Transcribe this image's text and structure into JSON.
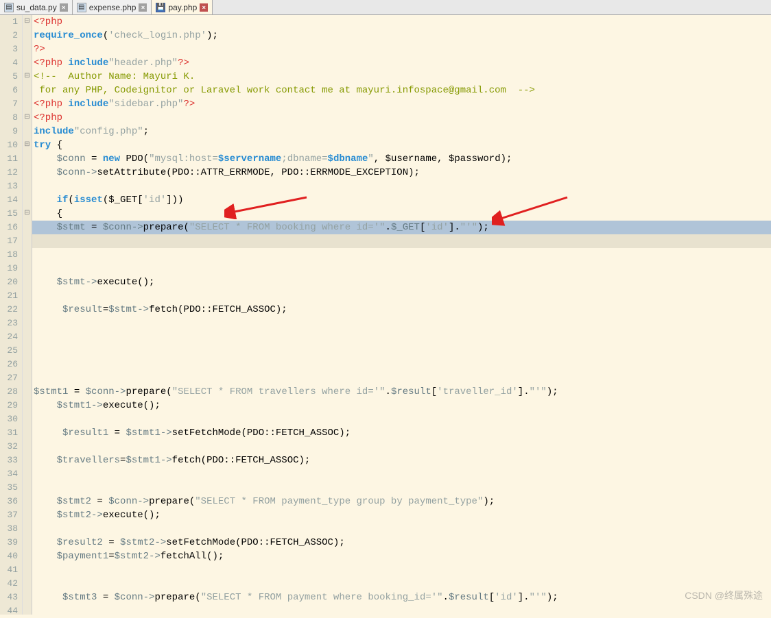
{
  "tabs": [
    {
      "label": "su_data.py",
      "icon": "file-icon",
      "closeStyle": "gray"
    },
    {
      "label": "expense.php",
      "icon": "file-icon",
      "closeStyle": "gray"
    },
    {
      "label": "pay.php",
      "icon": "save-icon",
      "active": true,
      "closeStyle": "red"
    }
  ],
  "gutter_start": 1,
  "gutter_end": 44,
  "fold_markers": {
    "1": "⊟",
    "5": "⊟",
    "8": "⊟",
    "10": "⊟",
    "15": "⊟"
  },
  "code_lines": {
    "l1": "<?php",
    "l2_a": "require_once",
    "l2_b": "(",
    "l2_c": "'check_login.php'",
    "l2_d": ");",
    "l3": "?>",
    "l4_a": "<?php ",
    "l4_b": "include",
    "l4_c": "\"header.php\"",
    "l4_d": "?>",
    "l5": "<!--  Author Name: Mayuri K. ",
    "l6": " for any PHP, Codeignitor or Laravel work contact me at mayuri.infospace@gmail.com  -->",
    "l7_a": "<?php ",
    "l7_b": "include",
    "l7_c": "\"sidebar.php\"",
    "l7_d": "?>",
    "l8": "<?php",
    "l9_a": "include",
    "l9_b": "\"config.php\"",
    "l9_c": ";",
    "l10_a": "try",
    "l10_b": " {",
    "l11_a": "    $conn",
    "l11_b": " = ",
    "l11_c": "new",
    "l11_d": " PDO(",
    "l11_e": "\"mysql:host=",
    "l11_f": "$servername",
    "l11_g": ";dbname=",
    "l11_h": "$dbname",
    "l11_i": "\"",
    "l11_j": ", $username, $password);",
    "l12_a": "    $conn",
    "l12_b": "->",
    "l12_c": "setAttribute(PDO::ATTR_ERRMODE, PDO::ERRMODE_EXCEPTION);",
    "l14_a": "    ",
    "l14_b": "if",
    "l14_c": "(",
    "l14_d": "isset",
    "l14_e": "($_GET[",
    "l14_f": "'id'",
    "l14_g": "]))",
    "l15": "    {",
    "l16_a": "    $stmt",
    "l16_b": " = ",
    "l16_c": "$conn",
    "l16_d": "->",
    "l16_e": "prepare(",
    "l16_f": "\"SELECT * FROM booking where id='\"",
    "l16_g": ".",
    "l16_h": "$_GET",
    "l16_i": "[",
    "l16_j": "'id'",
    "l16_k": "].",
    "l16_l": "\"'\"",
    "l16_m": ");",
    "l20_a": "    $stmt",
    "l20_b": "->",
    "l20_c": "execute();",
    "l22_a": "     $result",
    "l22_b": "=",
    "l22_c": "$stmt",
    "l22_d": "->",
    "l22_e": "fetch(PDO::FETCH_ASSOC);",
    "l28_a": "$stmt1",
    "l28_b": " = ",
    "l28_c": "$conn",
    "l28_d": "->",
    "l28_e": "prepare(",
    "l28_f": "\"SELECT * FROM travellers where id='\"",
    "l28_g": ".",
    "l28_h": "$result",
    "l28_i": "[",
    "l28_j": "'traveller_id'",
    "l28_k": "].",
    "l28_l": "\"'\"",
    "l28_m": ");",
    "l29_a": "    $stmt1",
    "l29_b": "->",
    "l29_c": "execute();",
    "l31_a": "     $result1",
    "l31_b": " = ",
    "l31_c": "$stmt1",
    "l31_d": "->",
    "l31_e": "setFetchMode(PDO::FETCH_ASSOC);",
    "l33_a": "    $travellers",
    "l33_b": "=",
    "l33_c": "$stmt1",
    "l33_d": "->",
    "l33_e": "fetch(PDO::FETCH_ASSOC);",
    "l36_a": "    $stmt2",
    "l36_b": " = ",
    "l36_c": "$conn",
    "l36_d": "->",
    "l36_e": "prepare(",
    "l36_f": "\"SELECT * FROM payment_type group by payment_type\"",
    "l36_g": ");",
    "l37_a": "    $stmt2",
    "l37_b": "->",
    "l37_c": "execute();",
    "l39_a": "    $result2",
    "l39_b": " = ",
    "l39_c": "$stmt2",
    "l39_d": "->",
    "l39_e": "setFetchMode(PDO::FETCH_ASSOC);",
    "l40_a": "    $payment1",
    "l40_b": "=",
    "l40_c": "$stmt2",
    "l40_d": "->",
    "l40_e": "fetchAll();",
    "l43_a": "     $stmt3",
    "l43_b": " = ",
    "l43_c": "$conn",
    "l43_d": "->",
    "l43_e": "prepare(",
    "l43_f": "\"SELECT * FROM payment where booking_id='\"",
    "l43_g": ".",
    "l43_h": "$result",
    "l43_i": "[",
    "l43_j": "'id'",
    "l43_k": "].",
    "l43_l": "\"'\"",
    "l43_m": ");"
  },
  "watermark": "CSDN @终属殊途"
}
